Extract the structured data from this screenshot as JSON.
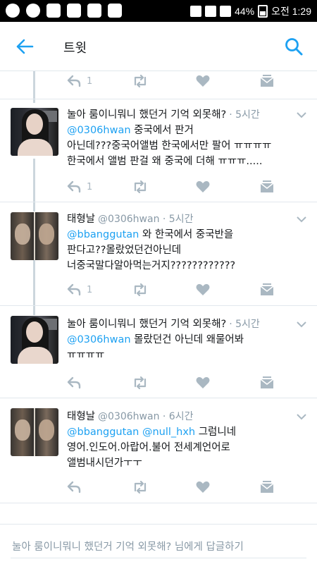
{
  "status_bar": {
    "battery": "44%",
    "time": "오전 1:29"
  },
  "header": {
    "title": "트윗"
  },
  "top_actions": {
    "reply_count": "1"
  },
  "tweets": [
    {
      "name": "눌아 룸이니뭐니 했던거 기억 외못해?",
      "meta": "· 5시간",
      "lines": [
        {
          "mention": "@0306hwan",
          "text": " 중국에서 판거"
        },
        {
          "text": "아닌데???중국어앨범 한국에서만 팔어 ㅠㅠㅠㅠ"
        },
        {
          "text": "한국에서 앨범 판걸 왜 중국에 더해 ㅠㅠㅠ....."
        }
      ],
      "reply_count": "1"
    },
    {
      "name": "태형날",
      "meta": "@0306hwan · 5시간",
      "lines": [
        {
          "mention": "@bbanggutan",
          "text": " 와 한국에서 중국반을"
        },
        {
          "text": "판다고??몰랐었던건아닌데"
        },
        {
          "text": "너중국말다알아먹는거지????????????"
        }
      ],
      "reply_count": "1"
    },
    {
      "name": "눌아 룸이니뭐니 했던거 기억 외못해?",
      "meta": "· 5시간",
      "lines": [
        {
          "mention": "@0306hwan",
          "text": "  몰랐던건 아닌데 왜물어봐"
        },
        {
          "text": "ㅠㅠㅠㅠ"
        }
      ],
      "reply_count": ""
    },
    {
      "name": "태형날",
      "meta": "@0306hwan · 6시간",
      "lines": [
        {
          "mention": "@bbanggutan @null_hxh",
          "text": " 그럼니네"
        },
        {
          "text": "영어.인도어.아랍어.불어 전세계언어로"
        },
        {
          "text": "앨범내시던가ㅜㅜ"
        }
      ],
      "reply_count": ""
    }
  ],
  "reply_bar": {
    "placeholder": "눌아 룸이니뭐니 했던거 기억 외못해? 님에게 답글하기"
  },
  "colors": {
    "accent": "#1da1f2",
    "icon": "#aab8c2",
    "meta": "#8899a6",
    "divider": "#e1e8ed"
  }
}
